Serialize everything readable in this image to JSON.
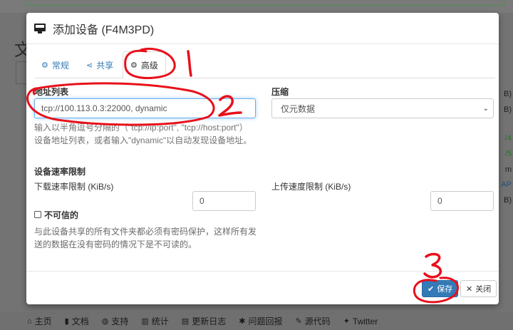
{
  "background": {
    "heading": "文",
    "right_col": [
      "B)",
      "B)",
      "/4",
      "/5",
      "m",
      "AP",
      "B)"
    ],
    "footer": [
      {
        "icon": "home-icon",
        "glyph": "⌂",
        "label": "主页"
      },
      {
        "icon": "book-icon",
        "glyph": "▮",
        "label": "文档"
      },
      {
        "icon": "support-icon",
        "glyph": "◍",
        "label": "支持"
      },
      {
        "icon": "stats-icon",
        "glyph": "▥",
        "label": "统计"
      },
      {
        "icon": "changelog-icon",
        "glyph": "▤",
        "label": "更新日志"
      },
      {
        "icon": "bug-icon",
        "glyph": "✱",
        "label": "问题回报"
      },
      {
        "icon": "wrench-icon",
        "glyph": "✎",
        "label": "源代码"
      },
      {
        "icon": "twitter-icon",
        "glyph": "✦",
        "label": "Twitter"
      }
    ]
  },
  "modal": {
    "title": "添加设备 (F4M3PD)",
    "tabs": [
      {
        "icon": "gear-icon",
        "glyph": "⚙",
        "label": "常规"
      },
      {
        "icon": "share-icon",
        "glyph": "⋖",
        "label": "共享"
      },
      {
        "icon": "gears-icon",
        "glyph": "⚙",
        "label": "高级"
      }
    ],
    "addresses": {
      "label": "地址列表",
      "value": "tcp://100.113.0.3:22000, dynamic",
      "help_line1": "输入以半角逗号分隔的（\"tcp://ip:port\", \"tcp://host:port\"）",
      "help_line2": "设备地址列表，或者输入\"dynamic\"以自动发现设备地址。"
    },
    "compression": {
      "label": "压缩",
      "selected": "仅元数据"
    },
    "rate_limit": {
      "label": "设备速率限制",
      "download_label": "下载速率限制 (KiB/s)",
      "download_value": "0",
      "upload_label": "上传速度限制 (KiB/s)",
      "upload_value": "0"
    },
    "untrusted": {
      "label": "不可信的",
      "help_line1": "与此设备共享的所有文件夹都必须有密码保护，这样所有发",
      "help_line2": "送的数据在没有密码的情况下是不可读的。"
    },
    "footer": {
      "save_label": "保存",
      "close_label": "关闭"
    }
  },
  "annotations": {
    "color": "#e8101a",
    "labels": [
      "1",
      "2",
      "3"
    ]
  }
}
